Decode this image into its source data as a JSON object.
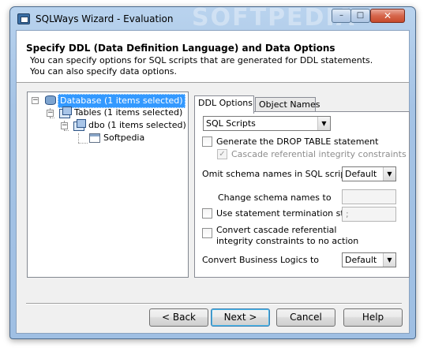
{
  "window": {
    "title": "SQLWays Wizard - Evaluation",
    "watermark": "SOFTPEDIA"
  },
  "header": {
    "title": "Specify DDL (Data Definition Language) and Data Options",
    "description": "You can specify options for SQL scripts that are generated for DDL statements. You can also specify data options."
  },
  "tree": {
    "nodes": [
      {
        "label": "Database (1 items selected)",
        "icon": "database-icon",
        "toggle": "−",
        "selected": true
      },
      {
        "label": "Tables (1 items selected)",
        "icon": "tables-icon",
        "toggle": "−"
      },
      {
        "label": "dbo (1 items selected)",
        "icon": "schema-icon",
        "toggle": "−"
      },
      {
        "label": "Softpedia",
        "icon": "table-icon"
      }
    ]
  },
  "tabs": [
    {
      "label": "DDL Options",
      "active": true
    },
    {
      "label": "Object Names",
      "active": false
    }
  ],
  "ddl": {
    "script_type": "SQL Scripts",
    "drop_table_label": "Generate the DROP TABLE statement",
    "drop_table_checked": false,
    "cascade_label": "Cascade referential integrity constraints",
    "cascade_checked": true,
    "omit_schema_label": "Omit schema names in SQL scripts",
    "omit_schema_value": "Default",
    "change_schema_label": "Change schema names to",
    "change_schema_value": "",
    "stmt_term_label": "Use statement termination string",
    "stmt_term_checked": false,
    "stmt_term_value": ";",
    "convert_cascade_line1": "Convert cascade referential",
    "convert_cascade_line2": "integrity constraints to no action",
    "convert_cascade_checked": false,
    "convert_logic_label": "Convert Business Logics to",
    "convert_logic_value": "Default"
  },
  "buttons": {
    "back": "< Back",
    "next": "Next >",
    "cancel": "Cancel",
    "help": "Help"
  },
  "caption": {
    "minimize": "–",
    "maximize": "□",
    "close": "✕"
  },
  "colors": {
    "selection": "#3399ff",
    "title_bar": "#a5c3e5"
  }
}
